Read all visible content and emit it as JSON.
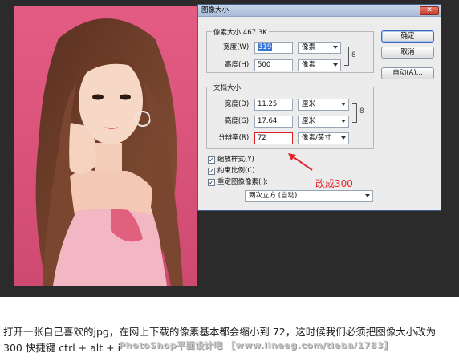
{
  "dialog": {
    "title": "图像大小",
    "close_icon": "x-icon",
    "pixel_dimensions": {
      "label": "像素大小:467.3K",
      "width_label": "宽度(W):",
      "width_value": "319",
      "width_unit": "像素",
      "height_label": "高度(H):",
      "height_value": "500",
      "height_unit": "像素"
    },
    "document_size": {
      "label": "文档大小:",
      "width_label": "宽度(D):",
      "width_value": "11.25",
      "width_unit": "厘米",
      "height_label": "高度(G):",
      "height_value": "17.64",
      "height_unit": "厘米",
      "resolution_label": "分辨率(R):",
      "resolution_value": "72",
      "resolution_unit": "像素/英寸"
    },
    "buttons": {
      "ok": "确定",
      "cancel": "取消",
      "auto": "自动(A)..."
    },
    "checkboxes": {
      "scale_styles": "缩放样式(Y)",
      "constrain": "约束比例(C)",
      "resample": "重定图像像素(I):"
    },
    "resample_method": "两次立方 (自动)"
  },
  "annotation": "改成300",
  "caption": "打开一张自己喜欢的jpg，在网上下载的像素基本都会缩小到 72，这时候我们必须把图像大小改为 300 快捷键 ctrl + alt + i",
  "watermark": "PhotoShop平面设计吧 【www.lineeg.com/tieba/1783】",
  "colors": {
    "photo_bg": "#d8567a",
    "annotation": "#e5232b",
    "dialog_bg": "#ececec"
  }
}
